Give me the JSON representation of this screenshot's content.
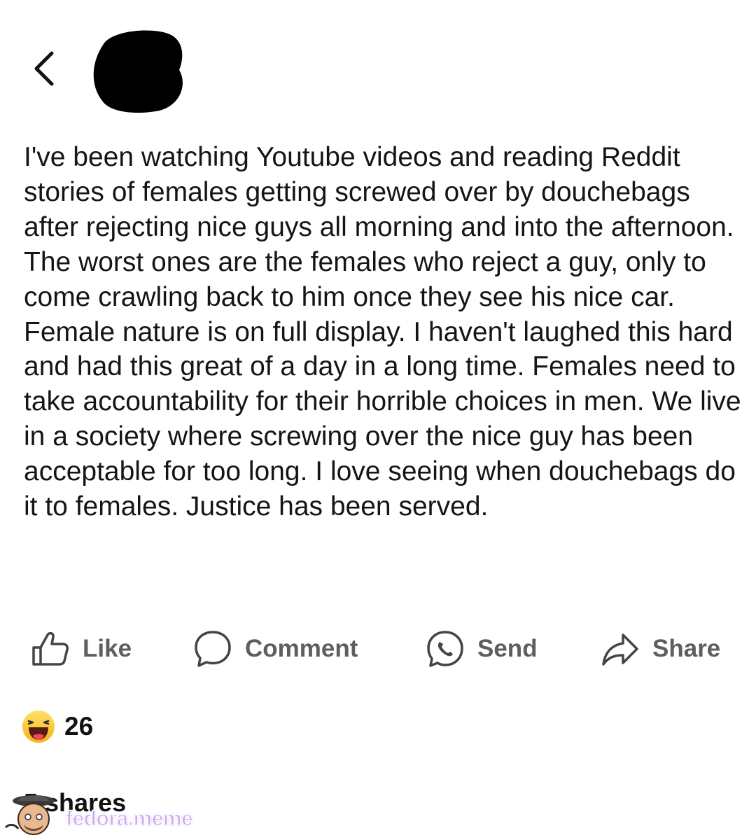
{
  "header": {
    "back_icon": "chevron-left-icon",
    "avatar": "redacted-avatar"
  },
  "post": {
    "text": "I've been watching Youtube videos and reading Reddit stories of females getting screwed over by douchebags after rejecting nice guys all morning and into the afternoon. The worst ones are the females who reject a guy, only to come crawling back to him once they see his nice car. Female nature is on full display. I haven't laughed this hard and had this great of a day in a long time. Females need to take accountability for their horrible choices in men. We live in a society where screwing over the nice guy has been acceptable for too long. I love seeing when douchebags do it to females. Justice has been served."
  },
  "actions": [
    {
      "label": "Like",
      "icon": "thumbs-up-icon"
    },
    {
      "label": "Comment",
      "icon": "comment-bubble-icon"
    },
    {
      "label": "Send",
      "icon": "messenger-icon"
    },
    {
      "label": "Share",
      "icon": "share-arrow-icon"
    }
  ],
  "reactions": {
    "icon": "haha-emoji-icon",
    "count": "26"
  },
  "shares": {
    "text": "5 shares"
  },
  "watermark": {
    "text": "fedora.meme",
    "icon": "fedora-mascot-icon"
  },
  "colors": {
    "text": "#151515",
    "action_gray": "#5e5e5e",
    "watermark": "#c9a8f2"
  }
}
